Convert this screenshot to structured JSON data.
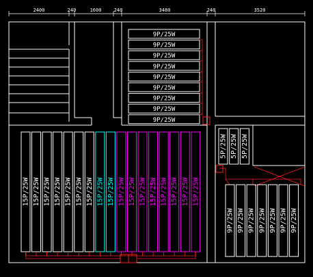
{
  "dimensions": [
    "2400",
    "240",
    "1600",
    "240",
    "3480",
    "240",
    "3520"
  ],
  "colors": {
    "background": "#000000",
    "line": "#ffffff",
    "white_group": "#ffffff",
    "cyan_group": "#00ffff",
    "magenta_group": "#ff00ff",
    "red_route": "#ff2020",
    "junction": "#ff2020"
  },
  "top_column": {
    "label": "9P/25W",
    "count": 9
  },
  "bottom_left_row": {
    "label": "15P/25W",
    "groups": [
      {
        "color_key": "white_group",
        "count": 7
      },
      {
        "color_key": "cyan_group",
        "count": 2
      },
      {
        "color_key": "magenta_group",
        "count": 8
      }
    ]
  },
  "small_right_row": {
    "label": "5P/25W",
    "count": 3
  },
  "bottom_right_row": {
    "label": "9P/25W",
    "count": 7
  }
}
